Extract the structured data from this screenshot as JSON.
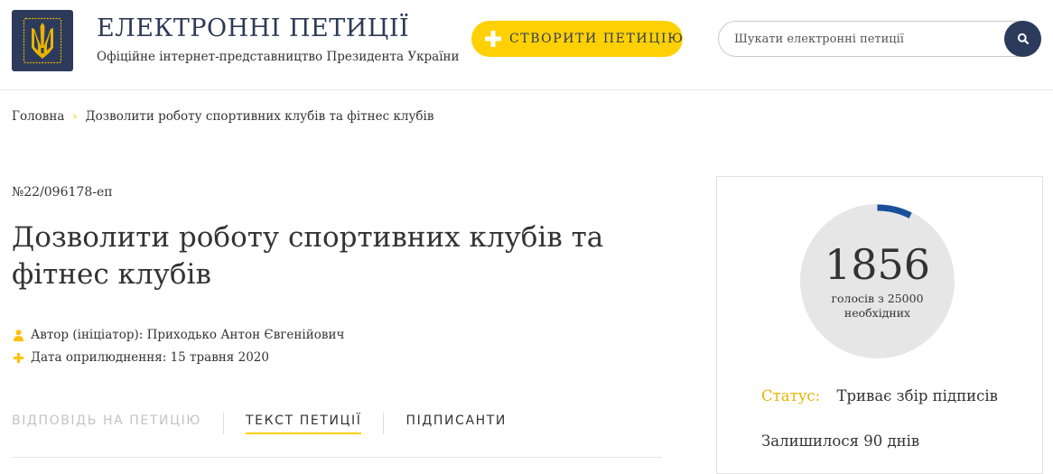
{
  "header": {
    "title": "ЕЛЕКТРОННІ ПЕТИЦІЇ",
    "subtitle": "Офіційне інтернет-представництво Президента України",
    "create_button": "СТВОРИТИ ПЕТИЦІЮ",
    "search_placeholder": "Шукати електронні петиції",
    "logo_icon": "trident-icon",
    "colors": {
      "accent": "#ffd104",
      "navy": "#2c3a5c",
      "progress": "#1a4f9c"
    }
  },
  "breadcrumb": {
    "home": "Головна",
    "current": "Дозволити роботу спортивних клубів та фітнес клубів"
  },
  "petition": {
    "number": "№22/096178-еп",
    "title": "Дозволити роботу спортивних клубів та фітнес клубів",
    "author": "Автор (ініціатор): Приходько Антон Євгенійович",
    "date": "Дата оприлюднення: 15 травня 2020"
  },
  "tabs": [
    {
      "label": "ВІДПОВІДЬ НА ПЕТИЦІЮ",
      "state": "disabled"
    },
    {
      "label": "ТЕКСТ ПЕТИЦІЇ",
      "state": "active"
    },
    {
      "label": "ПІДПИСАНТИ",
      "state": "normal"
    }
  ],
  "votes": {
    "count": "1856",
    "label_line1": "голосів з 25000",
    "label_line2": "необхідних",
    "collected": 1856,
    "required": 25000
  },
  "status": {
    "label": "Статус:",
    "value": "Триває збір підписів",
    "remaining": "Залишилося 90 днів"
  }
}
